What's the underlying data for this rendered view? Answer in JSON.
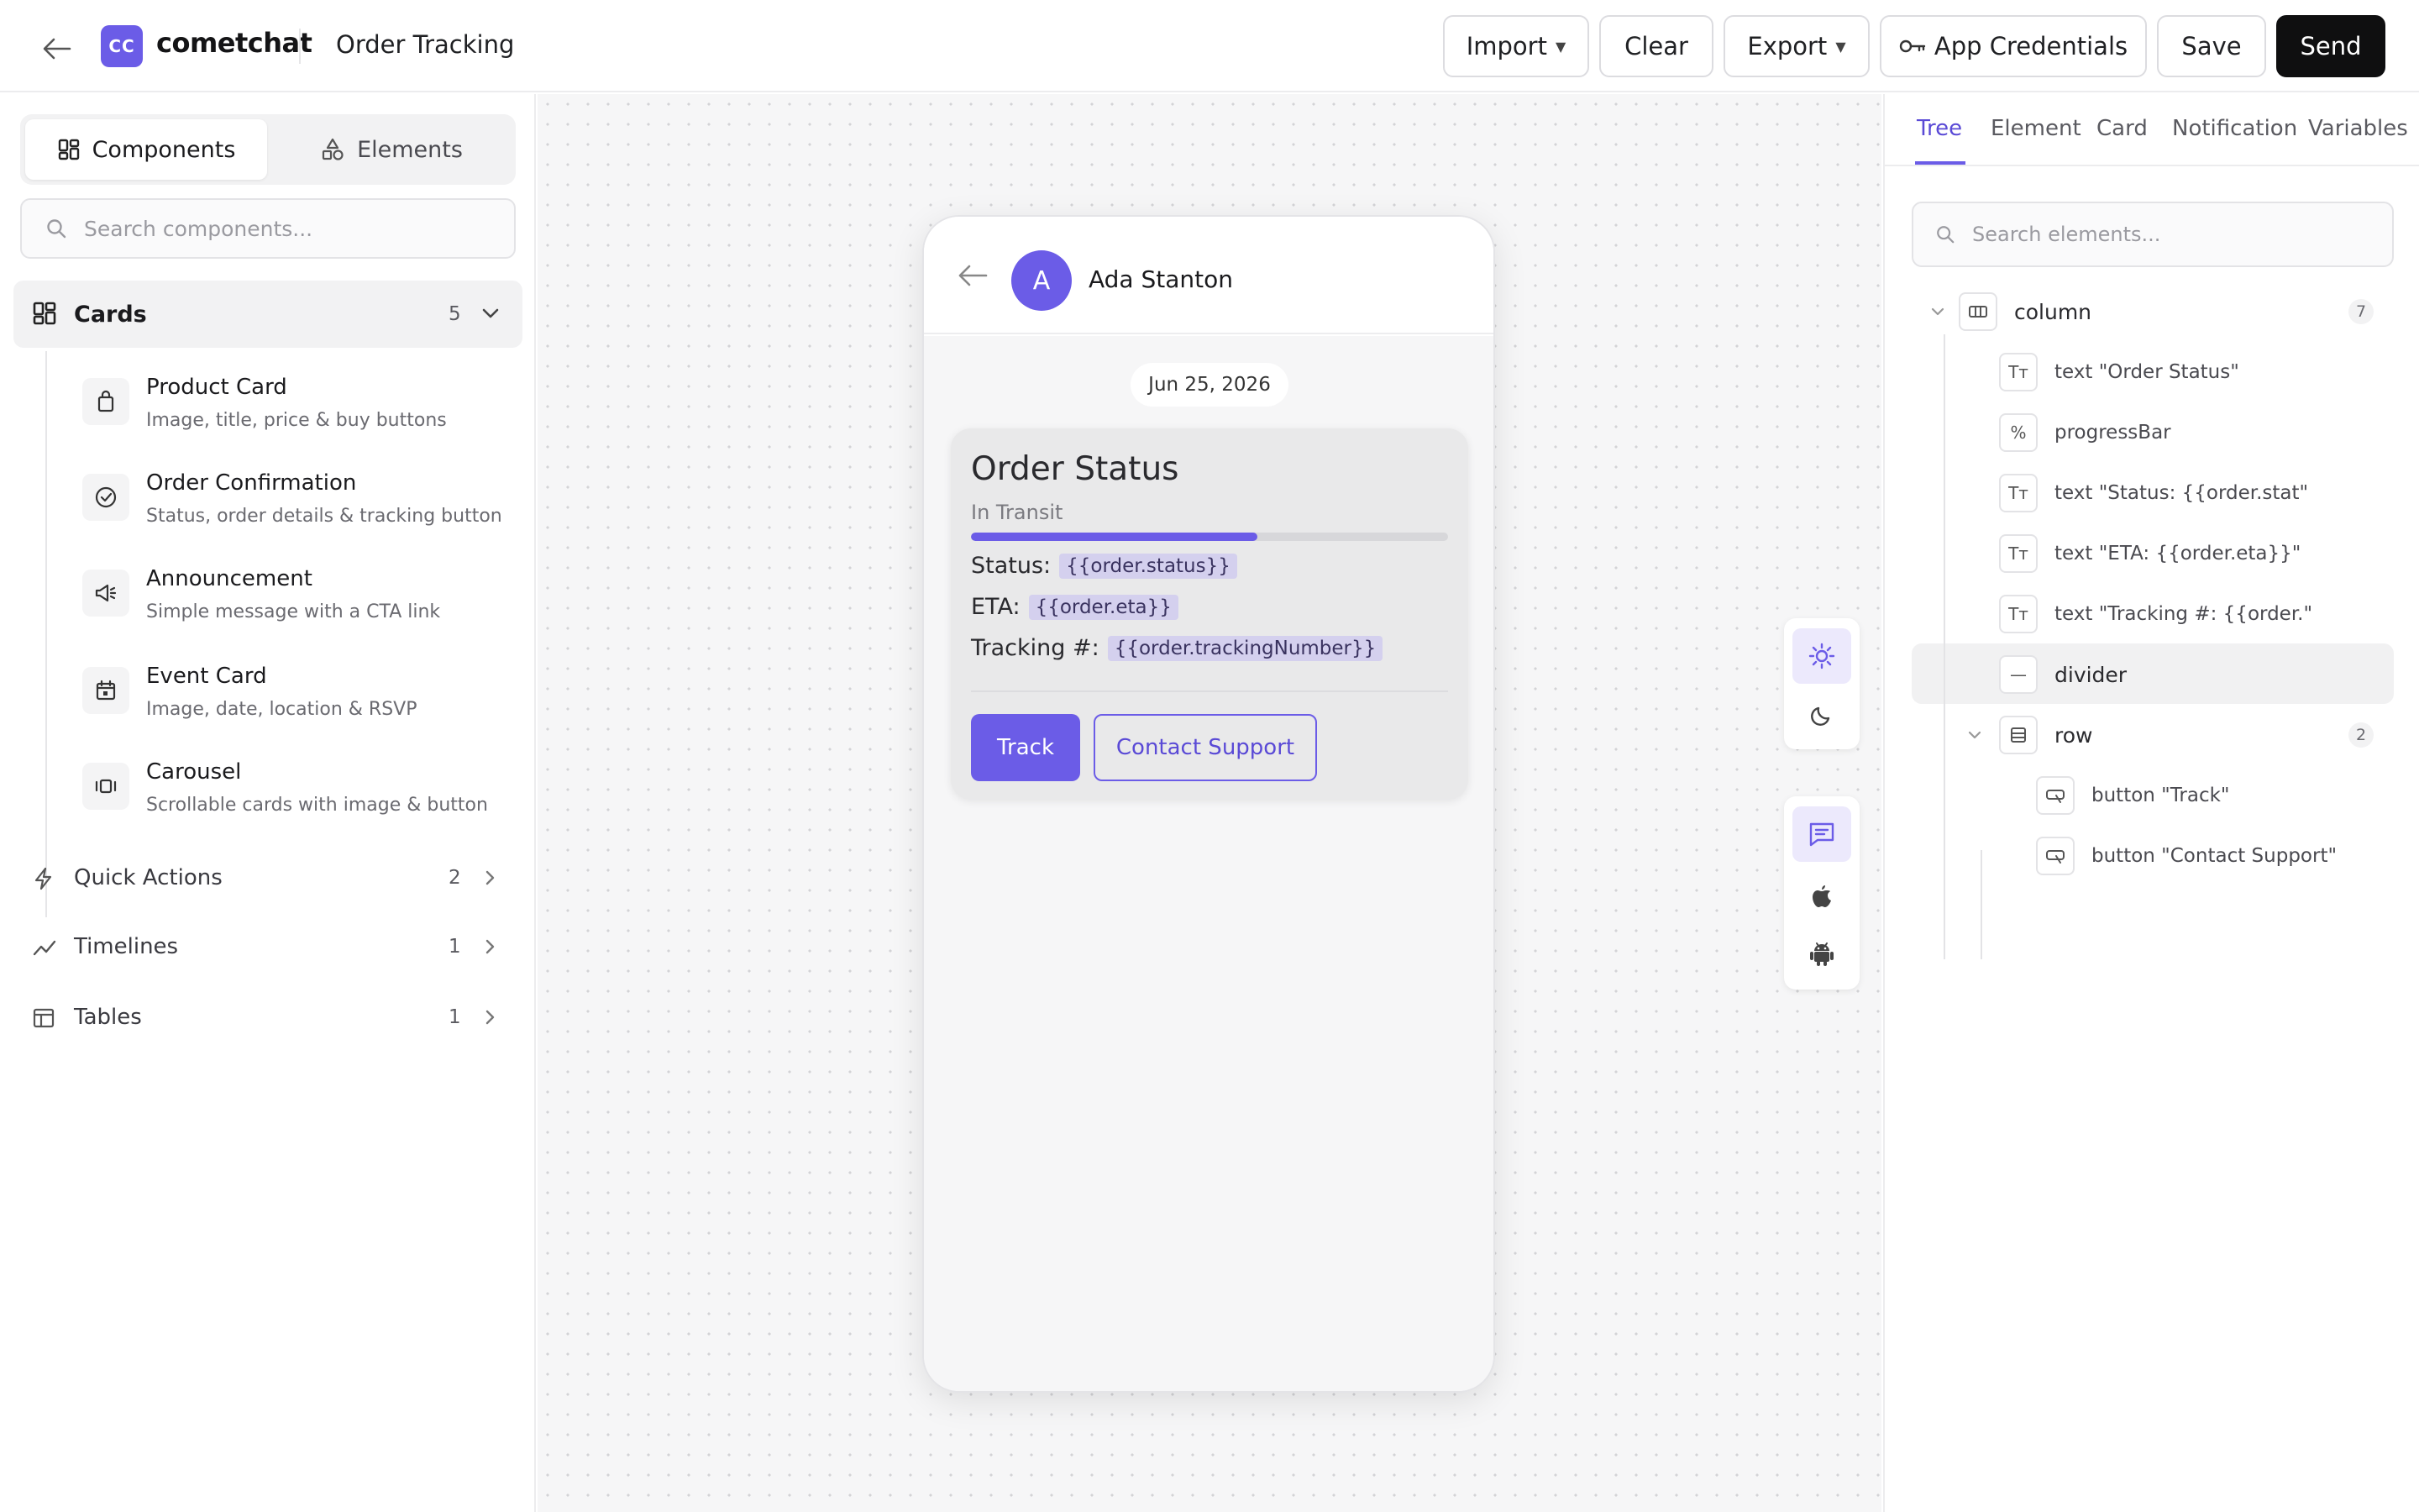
{
  "header": {
    "brand": "cometchat",
    "logo_text": "CC",
    "page_title": "Order Tracking",
    "buttons": {
      "import": "Import",
      "clear": "Clear",
      "export": "Export",
      "credentials": "App Credentials",
      "save": "Save",
      "send": "Send"
    }
  },
  "sidebar": {
    "tabs": {
      "components": "Components",
      "elements": "Elements"
    },
    "search_placeholder": "Search components...",
    "cards": {
      "label": "Cards",
      "count": "5"
    },
    "items": [
      {
        "title": "Product Card",
        "desc": "Image, title, price & buy buttons",
        "icon": "shopping-bag-icon"
      },
      {
        "title": "Order Confirmation",
        "desc": "Status, order details & tracking button",
        "icon": "check-circle-icon"
      },
      {
        "title": "Announcement",
        "desc": "Simple message with a CTA link",
        "icon": "megaphone-icon"
      },
      {
        "title": "Event Card",
        "desc": "Image, date, location & RSVP",
        "icon": "calendar-icon"
      },
      {
        "title": "Carousel",
        "desc": "Scrollable cards with image & button",
        "icon": "carousel-icon"
      }
    ],
    "categories": [
      {
        "label": "Quick Actions",
        "count": "2",
        "icon": "lightning-icon"
      },
      {
        "label": "Timelines",
        "count": "1",
        "icon": "trend-line-icon"
      },
      {
        "label": "Tables",
        "count": "1",
        "icon": "table-icon"
      }
    ]
  },
  "preview": {
    "avatar_letter": "A",
    "contact_name": "Ada Stanton",
    "date": "Jun 25, 2026",
    "card": {
      "title": "Order Status",
      "subtitle": "In Transit",
      "progress": 0.6,
      "status_label": "Status:",
      "status_value": "{{order.status}}",
      "eta_label": "ETA:",
      "eta_value": "{{order.eta}}",
      "tracking_label": "Tracking #:",
      "tracking_value": "{{order.trackingNumber}}",
      "track_button": "Track",
      "support_button": "Contact Support"
    },
    "accent": "#6b5ce7"
  },
  "inspector": {
    "tabs": [
      "Tree",
      "Element",
      "Card",
      "Notification",
      "Variables"
    ],
    "active_tab": "Tree",
    "search_placeholder": "Search elements...",
    "tree": {
      "column_label": "column",
      "column_count": "7",
      "n1": "text  \"Order Status\"",
      "n2": "progressBar",
      "n3": "text  \"Status: {{order.stat\"",
      "n4": "text  \"ETA: {{order.eta}}\"",
      "n5": "text  \"Tracking #: {{order.\"",
      "n6": "divider",
      "row_label": "row",
      "row_count": "2",
      "b1": "button  \"Track\"",
      "b2": "button  \"Contact Support\""
    }
  }
}
